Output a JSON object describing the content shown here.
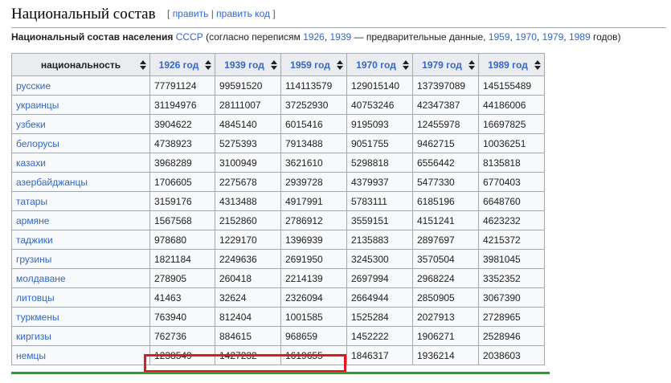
{
  "section": {
    "title": "Национальный состав",
    "edit": "править",
    "separator": "|",
    "edit_code": "править код",
    "bracket_open": "[",
    "bracket_close": "]"
  },
  "intro": {
    "bold": "Национальный состав населения",
    "link_ussr": "СССР",
    "text_a": "(согласно переписям",
    "y1926": "1926",
    "y1939": "1939",
    "text_b": "— предварительные данные,",
    "y1959": "1959",
    "y1970": "1970",
    "y1979": "1979",
    "y1989": "1989",
    "text_c": "годов)"
  },
  "table": {
    "headers": [
      "национальность",
      "1926 год",
      "1939 год",
      "1959 год",
      "1970 год",
      "1979 год",
      "1989 год"
    ],
    "rows": [
      [
        "русские",
        "77791124",
        "99591520",
        "114113579",
        "129015140",
        "137397089",
        "145155489"
      ],
      [
        "украинцы",
        "31194976",
        "28111007",
        "37252930",
        "40753246",
        "42347387",
        "44186006"
      ],
      [
        "узбеки",
        "3904622",
        "4845140",
        "6015416",
        "9195093",
        "12455978",
        "16697825"
      ],
      [
        "белорусы",
        "4738923",
        "5275393",
        "7913488",
        "9051755",
        "9462715",
        "10036251"
      ],
      [
        "казахи",
        "3968289",
        "3100949",
        "3621610",
        "5298818",
        "6556442",
        "8135818"
      ],
      [
        "азербайджанцы",
        "1706605",
        "2275678",
        "2939728",
        "4379937",
        "5477330",
        "6770403"
      ],
      [
        "татары",
        "3159176",
        "4313488",
        "4917991",
        "5783111",
        "6185196",
        "6648760"
      ],
      [
        "армяне",
        "1567568",
        "2152860",
        "2786912",
        "3559151",
        "4151241",
        "4623232"
      ],
      [
        "таджики",
        "978680",
        "1229170",
        "1396939",
        "2135883",
        "2897697",
        "4215372"
      ],
      [
        "грузины",
        "1821184",
        "2249636",
        "2691950",
        "3245300",
        "3570504",
        "3981045"
      ],
      [
        "молдаване",
        "278905",
        "260418",
        "2214139",
        "2697994",
        "2968224",
        "3352352"
      ],
      [
        "литовцы",
        "41463",
        "32624",
        "2326094",
        "2664944",
        "2850905",
        "3067390"
      ],
      [
        "туркмены",
        "763940",
        "812404",
        "1001585",
        "1525284",
        "2027913",
        "2728965"
      ],
      [
        "киргизы",
        "762736",
        "884615",
        "968659",
        "1452222",
        "1906271",
        "2528946"
      ],
      [
        "немцы",
        "1238549",
        "1427232",
        "1619655",
        "1846317",
        "1936214",
        "2038603"
      ]
    ]
  },
  "annotations": {
    "highlight_color": "#e0191f",
    "underline_color": "#21a02a"
  }
}
